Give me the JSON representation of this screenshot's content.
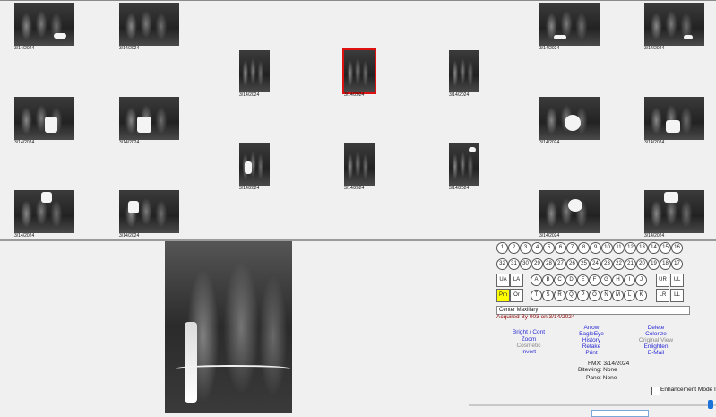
{
  "thumbnails": {
    "date": "3/14/2024"
  },
  "tooth_row_upper": [
    "1",
    "2",
    "3",
    "4",
    "5",
    "6",
    "7",
    "8",
    "9",
    "10",
    "11",
    "12",
    "13",
    "14",
    "15",
    "16"
  ],
  "tooth_row_lower": [
    "32",
    "31",
    "30",
    "29",
    "28",
    "27",
    "26",
    "25",
    "24",
    "23",
    "22",
    "21",
    "20",
    "19",
    "18",
    "17"
  ],
  "region_buttons": {
    "ua": "UA",
    "la": "LA",
    "ur": "UR",
    "ul": "UL",
    "pm": "Pm",
    "or": "Or",
    "lr": "LR",
    "ll": "LL"
  },
  "letters_upper": [
    "A",
    "B",
    "C",
    "D",
    "E",
    "F",
    "G",
    "H",
    "I",
    "J"
  ],
  "letters_lower": [
    "T",
    "S",
    "R",
    "Q",
    "P",
    "O",
    "N",
    "M",
    "L",
    "K"
  ],
  "description": "Center Maxillary",
  "acquired": "Acquired By 003 on 3/14/2024",
  "actions": {
    "col1": [
      "Bright / Cont",
      "Zoom",
      "Cosmetic",
      "Invert"
    ],
    "col2": [
      "Arrow",
      "EagleEye",
      "History",
      "Retake",
      "Print"
    ],
    "col3": [
      "Delete",
      "Colorize",
      "Original View",
      "Enlighten",
      "E-Mail"
    ]
  },
  "info": {
    "fmx": "FMX: 3/14/2024",
    "bitewing": "Bitewing: None",
    "pano": "Pano: None"
  },
  "enhancement_label": "Enhancement Mode I"
}
